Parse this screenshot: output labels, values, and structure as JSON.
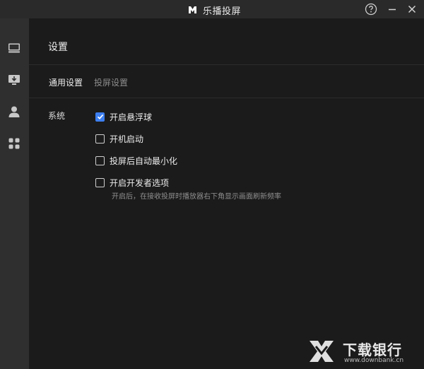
{
  "window": {
    "title": "乐播投屏"
  },
  "sidebar": {
    "items": [
      {
        "icon": "monitor-icon"
      },
      {
        "icon": "download-icon"
      },
      {
        "icon": "user-icon"
      },
      {
        "icon": "apps-icon"
      }
    ]
  },
  "main": {
    "title": "设置",
    "tabs": [
      {
        "label": "通用设置",
        "active": true
      },
      {
        "label": "投屏设置",
        "active": false
      }
    ],
    "section_label": "系统",
    "options": [
      {
        "label": "开启悬浮球",
        "checked": true
      },
      {
        "label": "开机启动",
        "checked": false
      },
      {
        "label": "投屏后自动最小化",
        "checked": false
      },
      {
        "label": "开启开发者选项",
        "checked": false
      }
    ],
    "hint": "开启后，在接收投屏时播放器右下角显示画面刷新频率"
  },
  "watermark": {
    "text": "下载银行",
    "url": "www.downbank.cn"
  },
  "colors": {
    "accent": "#3d7ff0",
    "sidebar_bg": "#2f2f2f",
    "main_bg": "#1b1b1b",
    "titlebar_bg": "#2a2a2a"
  }
}
